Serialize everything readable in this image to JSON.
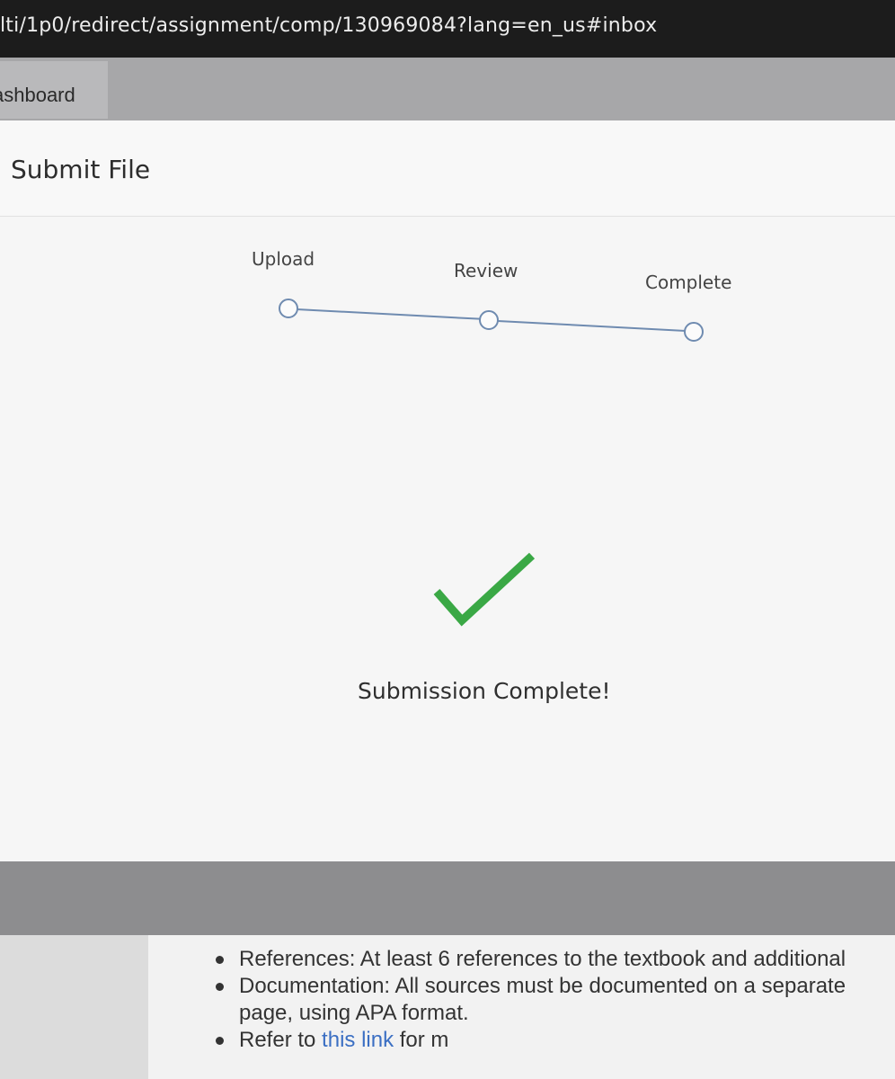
{
  "browser": {
    "url": "lti/1p0/redirect/assignment/comp/130969084?lang=en_us#inbox"
  },
  "nav": {
    "tab_label": "ashboard"
  },
  "modal": {
    "title": "Submit File",
    "steps": [
      {
        "label": "Upload"
      },
      {
        "label": "Review"
      },
      {
        "label": "Complete"
      }
    ],
    "message": "Submission Complete!",
    "colors": {
      "accent": "#6f8bb0",
      "success": "#3aa845"
    }
  },
  "content": {
    "items": [
      {
        "text": "References: At least 6 references to the textbook and additional"
      },
      {
        "text": "Documentation: All sources must be documented on a separate"
      },
      {
        "text": "page, using APA format."
      },
      {
        "text_before": "Refer to ",
        "link": "this link",
        "text_after": " for m"
      }
    ]
  }
}
